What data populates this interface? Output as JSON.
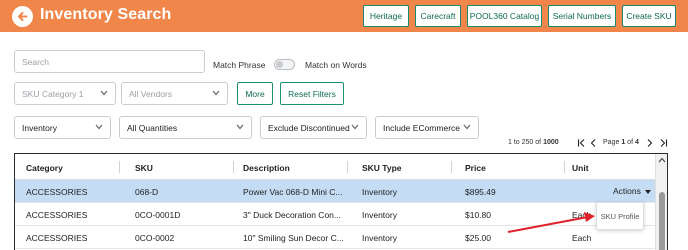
{
  "header": {
    "title": "Inventory Search",
    "buttons": [
      "Heritage",
      "Carecraft",
      "POOL360 Catalog",
      "Serial Numbers",
      "Create SKU"
    ]
  },
  "filters": {
    "search_placeholder": "Search",
    "match_phrase": "Match Phrase",
    "match_words": "Match on Words",
    "sku_category": "SKU Category 1",
    "vendors": "All Vendors",
    "more": "More",
    "reset": "Reset Filters",
    "inventory": "Inventory",
    "quantities": "All Quantities",
    "discontinued": "Exclude Discontinued",
    "ecommerce": "Include ECommerce"
  },
  "pagination": {
    "range": "1 to 250",
    "of_label": "of",
    "total": "1000",
    "page_label": "Page",
    "page": "1",
    "page_of": "of",
    "pages": "4"
  },
  "table": {
    "columns": [
      "Category",
      "SKU",
      "Description",
      "SKU Type",
      "Price",
      "Unit"
    ],
    "rows": [
      {
        "category": "ACCESSORIES",
        "sku": "068-D",
        "description": "Power Vac 068-D Mini C...",
        "type": "Inventory",
        "price": "$895.49",
        "unit": ""
      },
      {
        "category": "ACCESSORIES",
        "sku": "0CO-0001D",
        "description": "3\" Duck Decoration Con...",
        "type": "Inventory",
        "price": "$10.80",
        "unit": "Each"
      },
      {
        "category": "ACCESSORIES",
        "sku": "0CO-0002",
        "description": "10\" Smiling Sun Decor C...",
        "type": "Inventory",
        "price": "$25.00",
        "unit": "Each"
      }
    ]
  },
  "actions_label": "Actions",
  "popover_label": "SKU Profile",
  "colors": {
    "header": "#f0864a",
    "accent_green": "#1f8f74",
    "selected_row": "#c4ddf5",
    "annotation_arrow": "#e0202a"
  }
}
